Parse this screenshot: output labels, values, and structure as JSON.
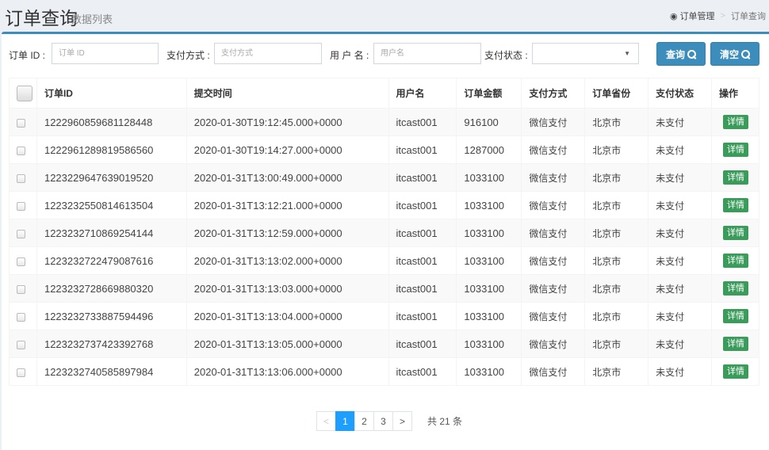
{
  "header": {
    "title": "订单查询",
    "subtitle": "数据列表",
    "breadcrumb": [
      {
        "label": "订单管理",
        "icon": "dashboard-icon"
      },
      {
        "label": "订单查询"
      }
    ],
    "breadcrumb_separator": ">"
  },
  "filters": {
    "order_id": {
      "label": "订单 ID :",
      "placeholder": "订单 ID",
      "value": ""
    },
    "pay_type": {
      "label": "支付方式 :",
      "placeholder": "支付方式",
      "value": ""
    },
    "username": {
      "label": "用 户 名 :",
      "placeholder": "用户名",
      "value": ""
    },
    "pay_status": {
      "label": "支付状态 :",
      "selected": ""
    },
    "query_button": "查询",
    "clear_button": "清空"
  },
  "table": {
    "columns": [
      "订单ID",
      "提交时间",
      "用户名",
      "订单金额",
      "支付方式",
      "订单省份",
      "支付状态",
      "操作"
    ],
    "rows": [
      {
        "id": "1222960859681128448",
        "time": "2020-01-30T19:12:45.000+0000",
        "user": "itcast001",
        "amount": "916100",
        "pay_type": "微信支付",
        "province": "北京市",
        "status": "未支付",
        "action": "详情"
      },
      {
        "id": "1222961289819586560",
        "time": "2020-01-30T19:14:27.000+0000",
        "user": "itcast001",
        "amount": "1287000",
        "pay_type": "微信支付",
        "province": "北京市",
        "status": "未支付",
        "action": "详情"
      },
      {
        "id": "1223229647639019520",
        "time": "2020-01-31T13:00:49.000+0000",
        "user": "itcast001",
        "amount": "1033100",
        "pay_type": "微信支付",
        "province": "北京市",
        "status": "未支付",
        "action": "详情"
      },
      {
        "id": "1223232550814613504",
        "time": "2020-01-31T13:12:21.000+0000",
        "user": "itcast001",
        "amount": "1033100",
        "pay_type": "微信支付",
        "province": "北京市",
        "status": "未支付",
        "action": "详情"
      },
      {
        "id": "1223232710869254144",
        "time": "2020-01-31T13:12:59.000+0000",
        "user": "itcast001",
        "amount": "1033100",
        "pay_type": "微信支付",
        "province": "北京市",
        "status": "未支付",
        "action": "详情"
      },
      {
        "id": "1223232722479087616",
        "time": "2020-01-31T13:13:02.000+0000",
        "user": "itcast001",
        "amount": "1033100",
        "pay_type": "微信支付",
        "province": "北京市",
        "status": "未支付",
        "action": "详情"
      },
      {
        "id": "1223232728669880320",
        "time": "2020-01-31T13:13:03.000+0000",
        "user": "itcast001",
        "amount": "1033100",
        "pay_type": "微信支付",
        "province": "北京市",
        "status": "未支付",
        "action": "详情"
      },
      {
        "id": "1223232733887594496",
        "time": "2020-01-31T13:13:04.000+0000",
        "user": "itcast001",
        "amount": "1033100",
        "pay_type": "微信支付",
        "province": "北京市",
        "status": "未支付",
        "action": "详情"
      },
      {
        "id": "1223232737423392768",
        "time": "2020-01-31T13:13:05.000+0000",
        "user": "itcast001",
        "amount": "1033100",
        "pay_type": "微信支付",
        "province": "北京市",
        "status": "未支付",
        "action": "详情"
      },
      {
        "id": "1223232740585897984",
        "time": "2020-01-31T13:13:06.000+0000",
        "user": "itcast001",
        "amount": "1033100",
        "pay_type": "微信支付",
        "province": "北京市",
        "status": "未支付",
        "action": "详情"
      }
    ]
  },
  "pagination": {
    "prev": "<",
    "next": ">",
    "pages": [
      "1",
      "2",
      "3"
    ],
    "current": "1",
    "total_text": "共 21 条"
  },
  "colors": {
    "primary": "#3c8dbc",
    "success": "#3a9b5a",
    "page_active": "#1e9fff"
  }
}
